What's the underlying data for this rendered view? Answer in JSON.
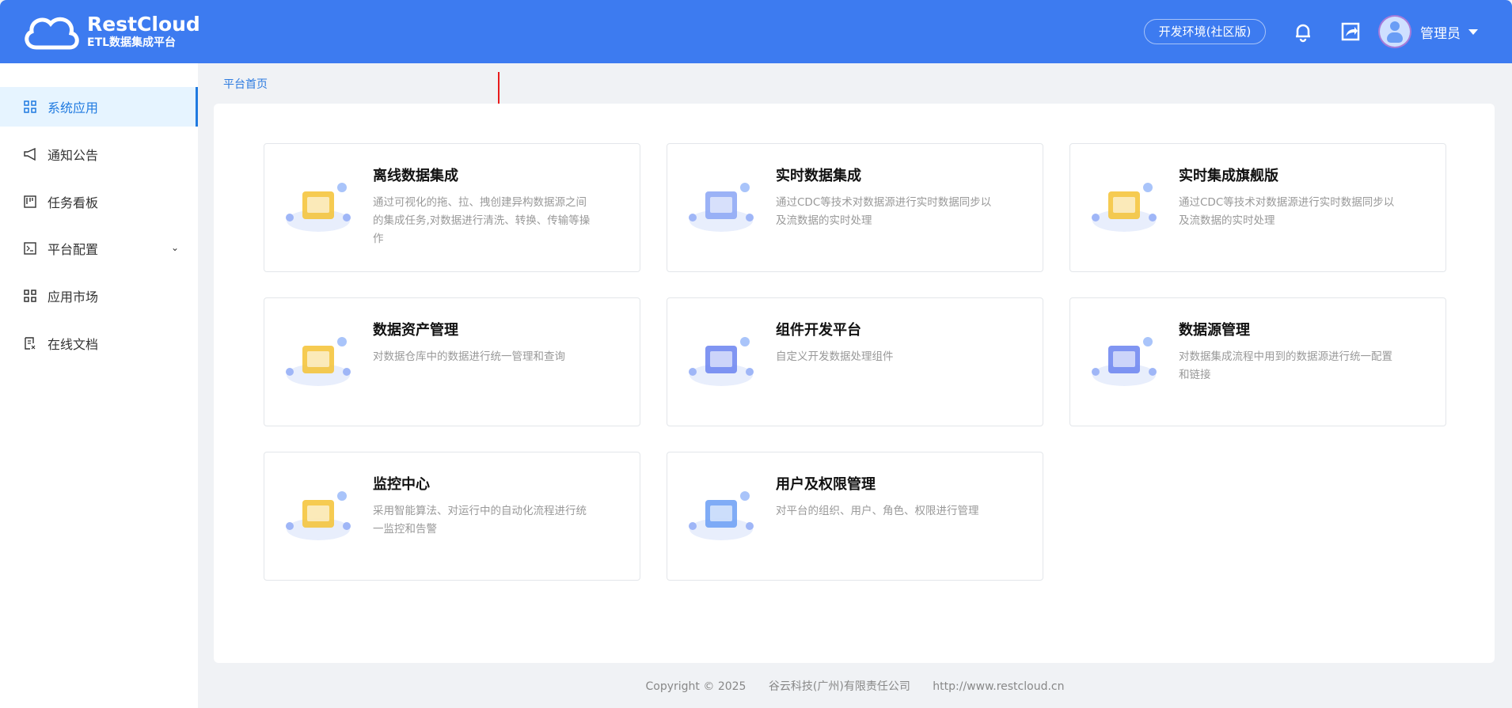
{
  "header": {
    "logo_title": "RestCloud",
    "logo_subtitle": "ETL数据集成平台",
    "env_label": "开发环境(社区版)",
    "user_name": "管理员",
    "accent": "#3d7bf0"
  },
  "sidebar": {
    "items": [
      {
        "label": "系统应用",
        "icon": "grid-icon",
        "active": true
      },
      {
        "label": "通知公告",
        "icon": "megaphone-icon"
      },
      {
        "label": "任务看板",
        "icon": "kanban-icon"
      },
      {
        "label": "平台配置",
        "icon": "terminal-icon",
        "has_submenu": true
      },
      {
        "label": "应用市场",
        "icon": "grid-icon"
      },
      {
        "label": "在线文档",
        "icon": "document-icon"
      }
    ]
  },
  "breadcrumb": "平台首页",
  "cards": [
    {
      "title": "离线数据集成",
      "desc": "通过可视化的拖、拉、拽创建异构数据源之间的集成任务,对数据进行清洗、转换、传输等操作",
      "color": "#f5c232"
    },
    {
      "title": "实时数据集成",
      "desc": "通过CDC等技术对数据源进行实时数据同步以及流数据的实时处理",
      "color": "#8aa5f5"
    },
    {
      "title": "实时集成旗舰版",
      "desc": "通过CDC等技术对数据源进行实时数据同步以及流数据的实时处理",
      "color": "#f5c232"
    },
    {
      "title": "数据资产管理",
      "desc": "对数据仓库中的数据进行统一管理和查询",
      "color": "#f5c232"
    },
    {
      "title": "组件开发平台",
      "desc": "自定义开发数据处理组件",
      "color": "#6a83f0"
    },
    {
      "title": "数据源管理",
      "desc": "对数据集成流程中用到的数据源进行统一配置和链接",
      "color": "#6a83f0"
    },
    {
      "title": "监控中心",
      "desc": "采用智能算法、对运行中的自动化流程进行统一监控和告警",
      "color": "#f5c232"
    },
    {
      "title": "用户及权限管理",
      "desc": "对平台的组织、用户、角色、权限进行管理",
      "color": "#6a9df5"
    }
  ],
  "footer": {
    "copyright": "Copyright © 2025",
    "company": "谷云科技(广州)有限责任公司",
    "url": "http://www.restcloud.cn"
  }
}
